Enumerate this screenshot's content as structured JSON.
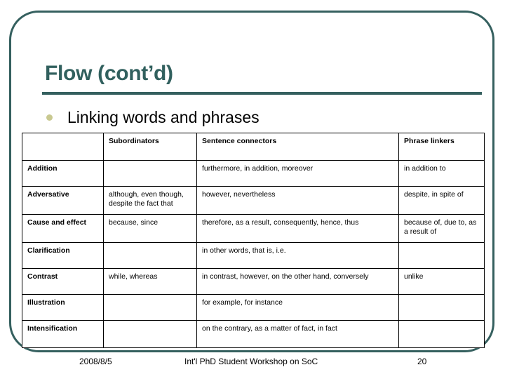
{
  "slide": {
    "title": "Flow (cont’d)",
    "bullet": {
      "marker": "bullet-dot",
      "text": "Linking words and phrases"
    },
    "accent_color": "#35605f",
    "title_color": "#31605e",
    "bullet_color": "#c9c991"
  },
  "table": {
    "columns": [
      "",
      "Subordinators",
      "Sentence connectors",
      "Phrase linkers"
    ],
    "rows": [
      {
        "category": "Addition",
        "subordinators": "",
        "sentence_connectors": "furthermore, in addition, moreover",
        "phrase_linkers": "in addition to"
      },
      {
        "category": "Adversative",
        "subordinators": "although, even though, despite the fact that",
        "sentence_connectors": "however, nevertheless",
        "phrase_linkers": "despite, in spite of"
      },
      {
        "category": "Cause and effect",
        "subordinators": "because, since",
        "sentence_connectors": "therefore, as a result, consequently, hence, thus",
        "phrase_linkers": "because of, due to, as a result of"
      },
      {
        "category": "Clarification",
        "subordinators": "",
        "sentence_connectors": "in other words, that is, i.e.",
        "phrase_linkers": ""
      },
      {
        "category": "Contrast",
        "subordinators": "while, whereas",
        "sentence_connectors": "in contrast, however, on the other hand, conversely",
        "phrase_linkers": "unlike"
      },
      {
        "category": "Illustration",
        "subordinators": "",
        "sentence_connectors": "for example, for instance",
        "phrase_linkers": ""
      },
      {
        "category": "Intensification",
        "subordinators": "",
        "sentence_connectors": "on the contrary, as a matter of fact, in fact",
        "phrase_linkers": ""
      }
    ]
  },
  "footer": {
    "date": "2008/8/5",
    "event": "Int'l PhD Student Workshop on SoC",
    "page_number": "20"
  }
}
